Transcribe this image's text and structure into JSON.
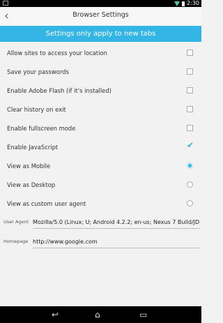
{
  "status_bar": {
    "time": "2:30"
  },
  "titlebar": {
    "title": "Browser Settings"
  },
  "banner": {
    "text": "Settings only apply to new tabs"
  },
  "settings": [
    {
      "label": "Allow sites to access your location",
      "control": "checkbox",
      "checked": false
    },
    {
      "label": "Save your passwords",
      "control": "checkbox",
      "checked": false
    },
    {
      "label": "Enable Adobe Flash (if it's installed)",
      "control": "checkbox",
      "checked": false
    },
    {
      "label": "Clear history on exit",
      "control": "checkbox",
      "checked": false
    },
    {
      "label": "Enable fullscreen mode",
      "control": "checkbox",
      "checked": false
    },
    {
      "label": "Enable JavaScript",
      "control": "checkbox",
      "checked": true
    },
    {
      "label": "View as Mobile",
      "control": "radio",
      "checked": true
    },
    {
      "label": "View as Desktop",
      "control": "radio",
      "checked": false
    },
    {
      "label": "View as custom user agent",
      "control": "radio",
      "checked": false
    }
  ],
  "user_agent": {
    "label": "User Agent",
    "value": "Mozilla/5.0 (Linux; U; Android 4.2.2; en-us; Nexus 7 Build/JD"
  },
  "homepage": {
    "label": "Homepage",
    "value": "http://www.google.com"
  },
  "colors": {
    "accent": "#33b5e5"
  }
}
